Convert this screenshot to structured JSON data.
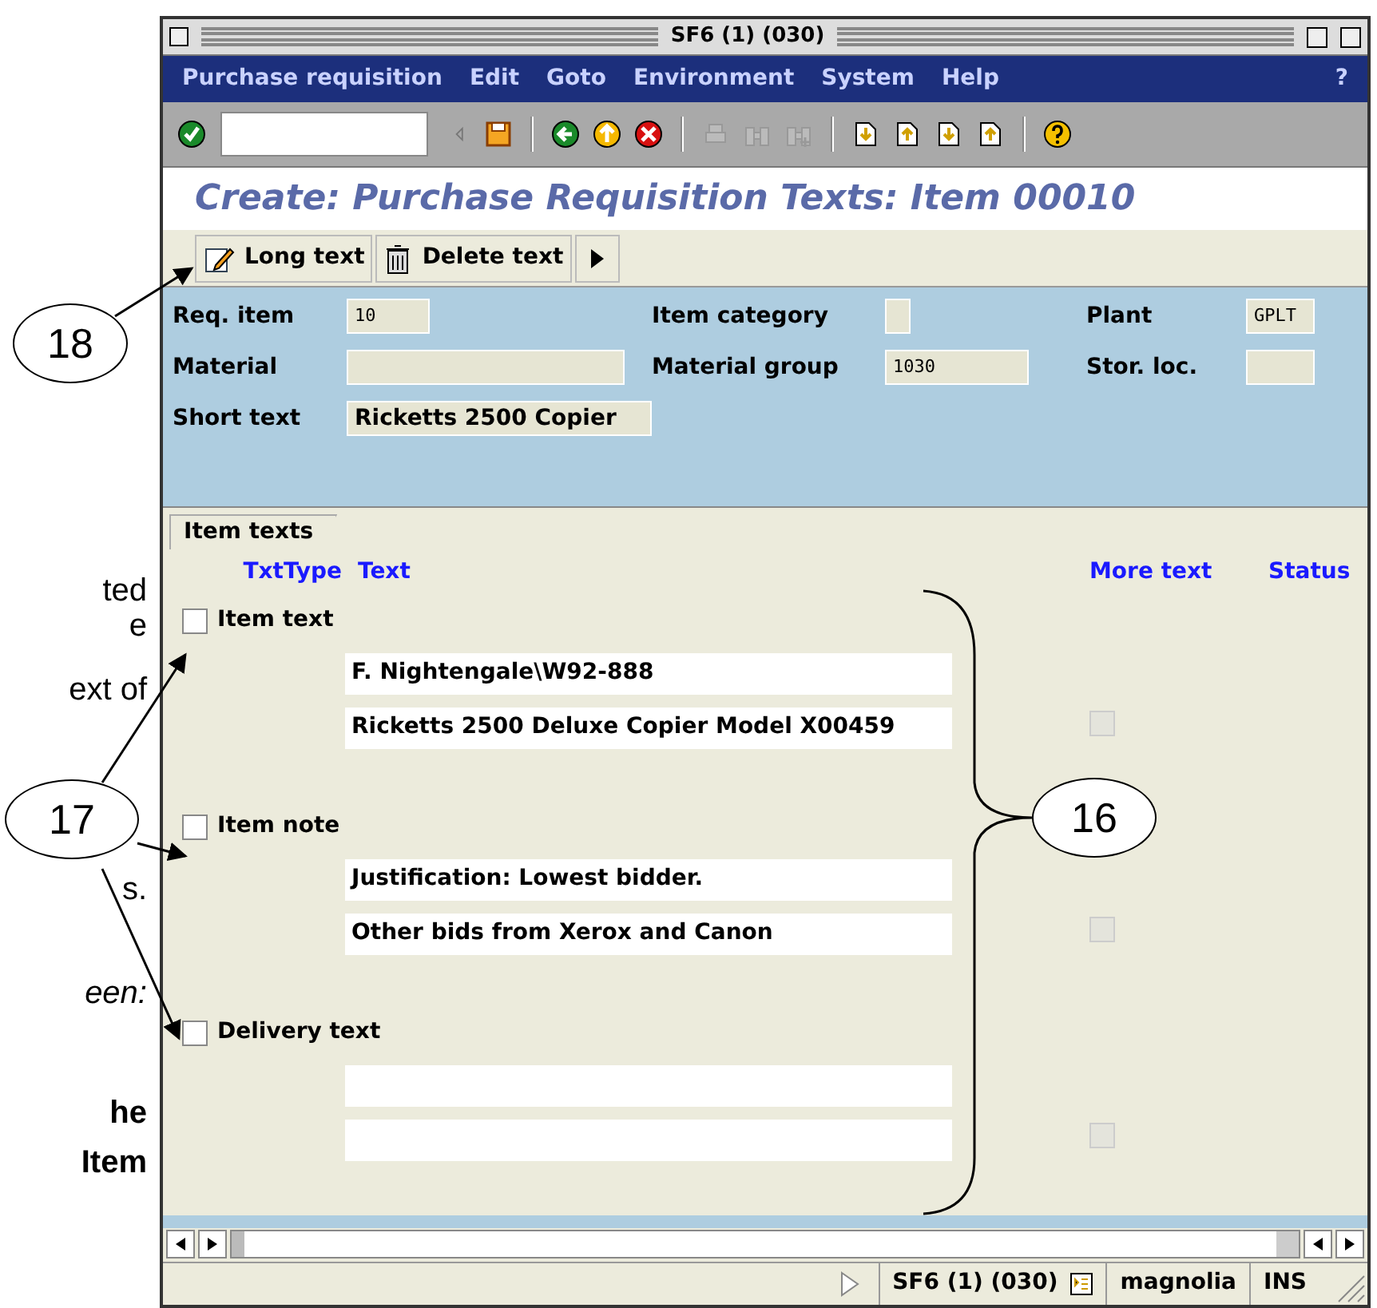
{
  "page_fragments": [
    "ted",
    "e",
    "ext of",
    "s.",
    "een:",
    "he",
    "Item"
  ],
  "callouts": [
    {
      "number": "18"
    },
    {
      "number": "17"
    },
    {
      "number": "16"
    }
  ],
  "window": {
    "title": "SF6 (1) (030)"
  },
  "menu": {
    "items": [
      "Purchase requisition",
      "Edit",
      "Goto",
      "Environment",
      "System",
      "Help"
    ],
    "help": "?"
  },
  "page_title": "Create: Purchase Requisition Texts: Item 00010",
  "app_toolbar": [
    {
      "label": "Long text",
      "kind": "pencil"
    },
    {
      "label": "Delete text",
      "kind": "trash"
    }
  ],
  "header_fields": [
    [
      {
        "label": "Req. item",
        "value": "10"
      },
      {
        "label": "Item category"
      },
      {
        "label": "Plant",
        "value": "GPLT"
      }
    ],
    [
      {
        "label": "Material"
      },
      {
        "label": "Material group",
        "value": "1030"
      },
      {
        "label": "Stor. loc."
      }
    ],
    [
      {
        "label": "Short text",
        "value": "Ricketts 2500 Copier"
      }
    ]
  ],
  "tab": {
    "label": "Item texts"
  },
  "columns": [
    "TxtType",
    "Text",
    "More text",
    "Status"
  ],
  "text_types": [
    {
      "label": "Item text",
      "checked": false,
      "lines": [
        "F. Nightengale\\W92-888",
        "Ricketts 2500 Deluxe Copier Model X00459"
      ],
      "more_text": false
    },
    {
      "label": "Item note",
      "checked": false,
      "lines": [
        "Justification: Lowest bidder.",
        "Other bids from Xerox and Canon"
      ],
      "more_text": false
    },
    {
      "label": "Delivery text",
      "checked": false,
      "more_text": false
    }
  ],
  "status_bar": {
    "system": "SF6 (1) (030)",
    "server": "magnolia",
    "mode": "INS"
  }
}
